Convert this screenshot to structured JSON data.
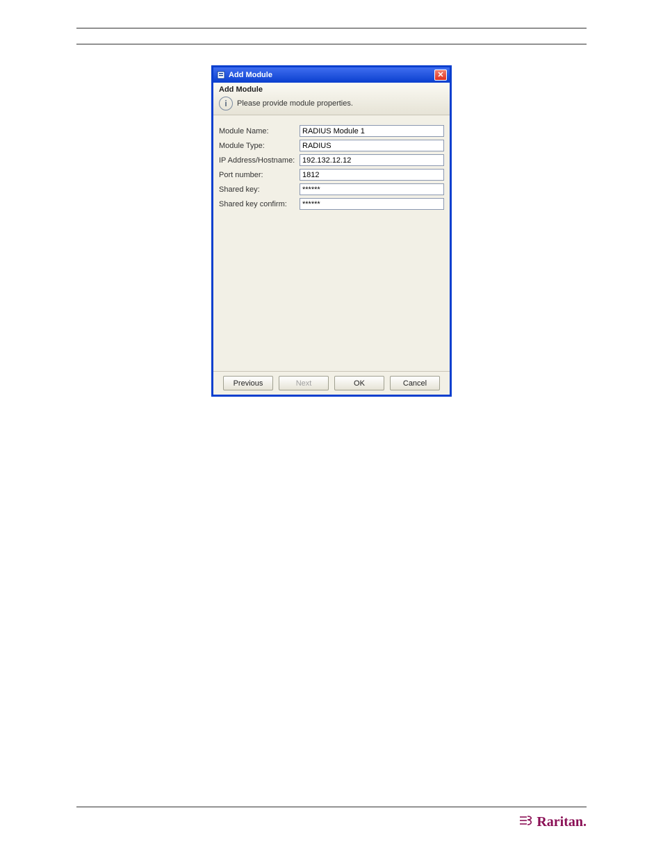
{
  "dialog": {
    "window_title": "Add Module",
    "panel_title": "Add Module",
    "info_text": "Please provide module properties.",
    "fields": {
      "module_name": {
        "label": "Module Name:",
        "value": "RADIUS Module 1"
      },
      "module_type": {
        "label": "Module Type:",
        "value": "RADIUS"
      },
      "ip_address": {
        "label": "IP Address/Hostname:",
        "value": "192.132.12.12"
      },
      "port_number": {
        "label": "Port number:",
        "value": "1812"
      },
      "shared_key": {
        "label": "Shared key:",
        "value": "******"
      },
      "shared_key_confirm": {
        "label": "Shared key confirm:",
        "value": "******"
      }
    },
    "buttons": {
      "previous": "Previous",
      "next": "Next",
      "ok": "OK",
      "cancel": "Cancel"
    }
  },
  "footer": {
    "brand": "Raritan."
  }
}
